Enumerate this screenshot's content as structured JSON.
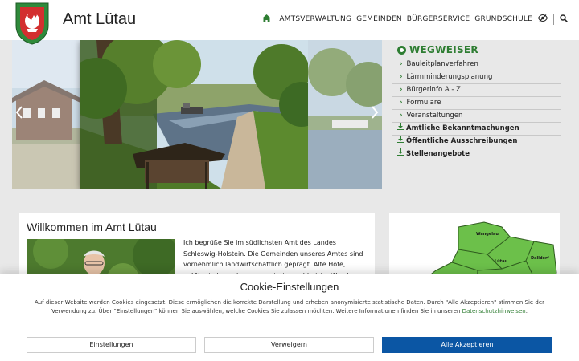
{
  "site": {
    "title": "Amt Lütau"
  },
  "nav": {
    "items": [
      {
        "label": "AMTSVERWALTUNG"
      },
      {
        "label": "GEMEINDEN"
      },
      {
        "label": "BÜRGERSERVICE"
      },
      {
        "label": "GRUNDSCHULE"
      }
    ]
  },
  "wegweiser": {
    "title": "WEGWEISER",
    "links": [
      {
        "label": "Bauleitplanverfahren"
      },
      {
        "label": "Lärmminderungsplanung"
      },
      {
        "label": "Bürgerinfo A - Z"
      },
      {
        "label": "Formulare"
      },
      {
        "label": "Veranstaltungen"
      }
    ],
    "downloads": [
      {
        "label": "Amtliche Bekanntmachungen"
      },
      {
        "label": "Öffentliche Ausschreibungen"
      },
      {
        "label": "Stellenangebote"
      }
    ]
  },
  "main": {
    "heading": "Willkommen im Amt Lütau",
    "intro": "Ich begrüße Sie im südlichsten Amt des Landes Schleswig-Holstein. Die Gemeinden unseres Amtes sind vornehmlich landwirtschaftlich geprägt. Alte Höfe, größtenteils modern ausgestattet, zahlreiche Wander- u. Radwege sowie die"
  },
  "map": {
    "labels": [
      "Wangelau",
      "Lütau",
      "Dalldorf"
    ]
  },
  "cookie": {
    "title": "Cookie-Einstellungen",
    "text": "Auf dieser Website werden Cookies eingesetzt. Diese ermöglichen die korrekte Darstellung und erheben anonymisierte statistische Daten. Durch \"Alle Akzeptieren\" stimmen Sie der Verwendung zu. Über \"Einstellungen\" können Sie auswählen, welche Cookies Sie zulassen möchten. Weitere Informationen finden Sie in unseren",
    "link": "Datenschutzhinweisen",
    "link_suffix": ".",
    "buttons": {
      "settings": "Einstellungen",
      "decline": "Verweigern",
      "accept": "Alle Akzeptieren"
    }
  },
  "colors": {
    "accent_green": "#2e7d32",
    "primary_blue": "#0b56a4"
  },
  "icons": {
    "home": "home-icon",
    "accessibility": "eye-slash-icon",
    "search": "search-icon",
    "slider_prev": "chevron-left-icon",
    "slider_next": "chevron-right-icon",
    "link": "chevron-right-icon",
    "download": "download-icon"
  }
}
